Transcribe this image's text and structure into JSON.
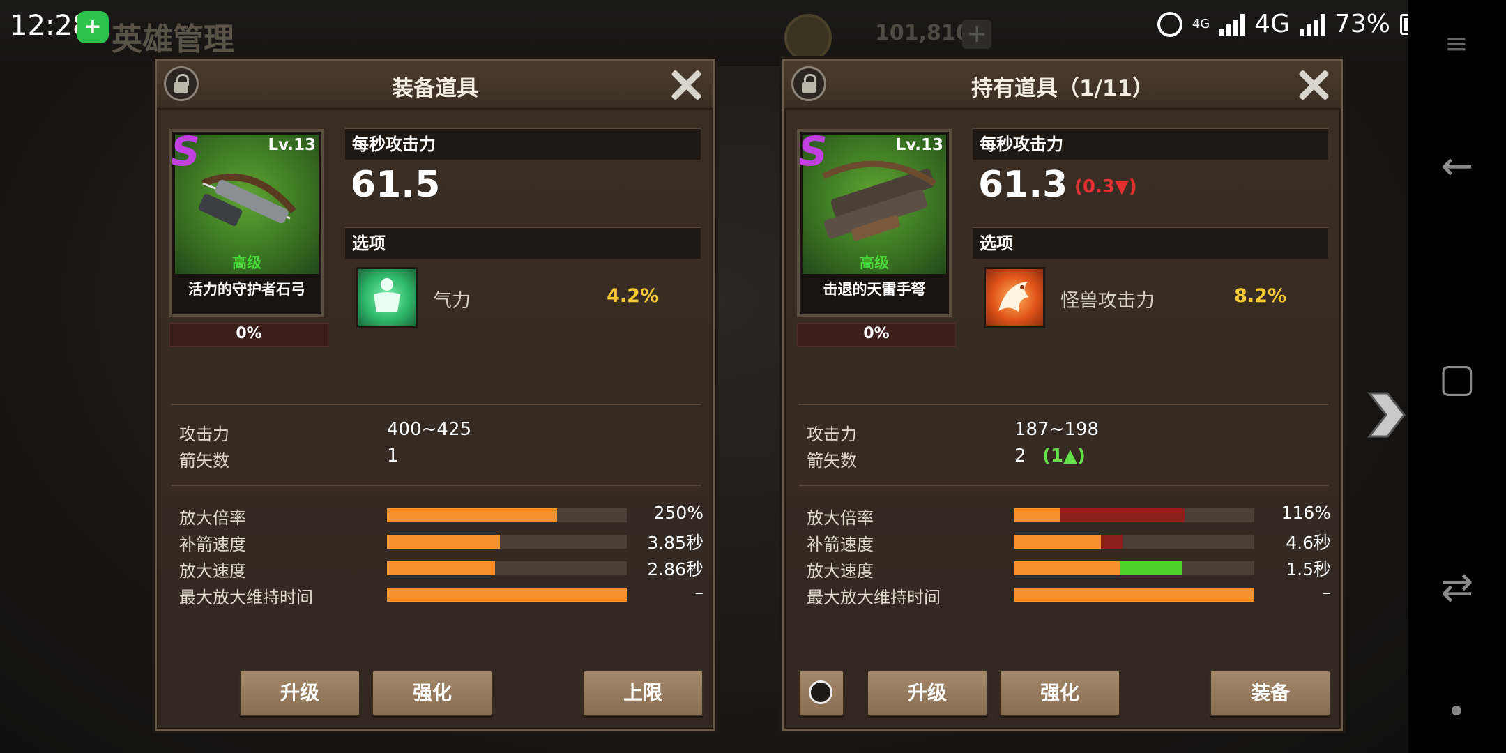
{
  "background": {
    "title": "英雄管理",
    "coins": "101,810",
    "plus": "+"
  },
  "status_bar": {
    "time": "12:28",
    "app_icon": "+",
    "network_small": "4G",
    "network": "4G",
    "battery": "73%"
  },
  "panels": [
    {
      "title": "装备道具",
      "item": {
        "rank": "S",
        "level": "Lv.13",
        "grade": "高级",
        "name": "活力的守护者石弓",
        "xp": "0%"
      },
      "dps_label": "每秒攻击力",
      "dps": "61.5",
      "options_label": "选项",
      "option": {
        "name": "气力",
        "value": "4.2%",
        "icon": "body-aura-icon"
      },
      "stats": [
        {
          "label": "攻击力",
          "value": "400~425"
        },
        {
          "label": "箭矢数",
          "value": "1"
        }
      ],
      "bars": [
        {
          "label": "放大倍率",
          "value": "250%",
          "fill": 0.71
        },
        {
          "label": "补箭速度",
          "value": "3.85秒",
          "fill": 0.47
        },
        {
          "label": "放大速度",
          "value": "2.86秒",
          "fill": 0.45
        },
        {
          "label": "最大放大维持时间",
          "value": "–",
          "fill": 1.0
        }
      ],
      "buttons": {
        "upgrade": "升级",
        "enhance": "强化",
        "limit": "上限"
      }
    },
    {
      "title": "持有道具（1/11）",
      "item": {
        "rank": "S",
        "level": "Lv.13",
        "grade": "高级",
        "name": "击退的天雷手弩",
        "xp": "0%"
      },
      "dps_label": "每秒攻击力",
      "dps": "61.3",
      "dps_diff": "(0.3▼)",
      "options_label": "选项",
      "option": {
        "name": "怪兽攻击力",
        "value": "8.2%",
        "icon": "dragon-icon"
      },
      "stats": [
        {
          "label": "攻击力",
          "value": "187~198"
        },
        {
          "label": "箭矢数",
          "value": "2",
          "diff": "(1▲)"
        }
      ],
      "bars": [
        {
          "label": "放大倍率",
          "value": "116%",
          "fill": 0.19,
          "ref": 0.71
        },
        {
          "label": "补箭速度",
          "value": "4.6秒",
          "fill": 0.36,
          "ref": 0.45
        },
        {
          "label": "放大速度",
          "value": "1.5秒",
          "fill": 0.44,
          "gain": 0.7
        },
        {
          "label": "最大放大维持时间",
          "value": "–",
          "fill": 1.0
        }
      ],
      "buttons": {
        "upgrade": "升级",
        "enhance": "强化",
        "equip": "装备"
      }
    }
  ],
  "colors": {
    "bar_fill": "#f7902e",
    "bar_loss": "#8f1f1b",
    "bar_gain": "#4ed12c",
    "option_value": "#f6c933",
    "rank": "#c040e0"
  }
}
